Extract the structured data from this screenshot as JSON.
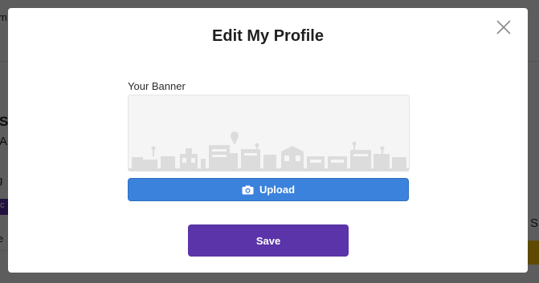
{
  "background": {
    "fragments": [
      "m",
      "S",
      "A",
      "g",
      "ec",
      "le",
      "S"
    ]
  },
  "modal": {
    "title": "Edit My Profile",
    "close_icon": "close-icon",
    "banner_label": "Your Banner",
    "banner_icon": "city-skyline-illustration",
    "upload_label": "Upload",
    "upload_icon": "camera-icon",
    "save_label": "Save"
  },
  "colors": {
    "upload_button": "#3b82dc",
    "save_button": "#5a34a8",
    "overlay": "#595959"
  }
}
